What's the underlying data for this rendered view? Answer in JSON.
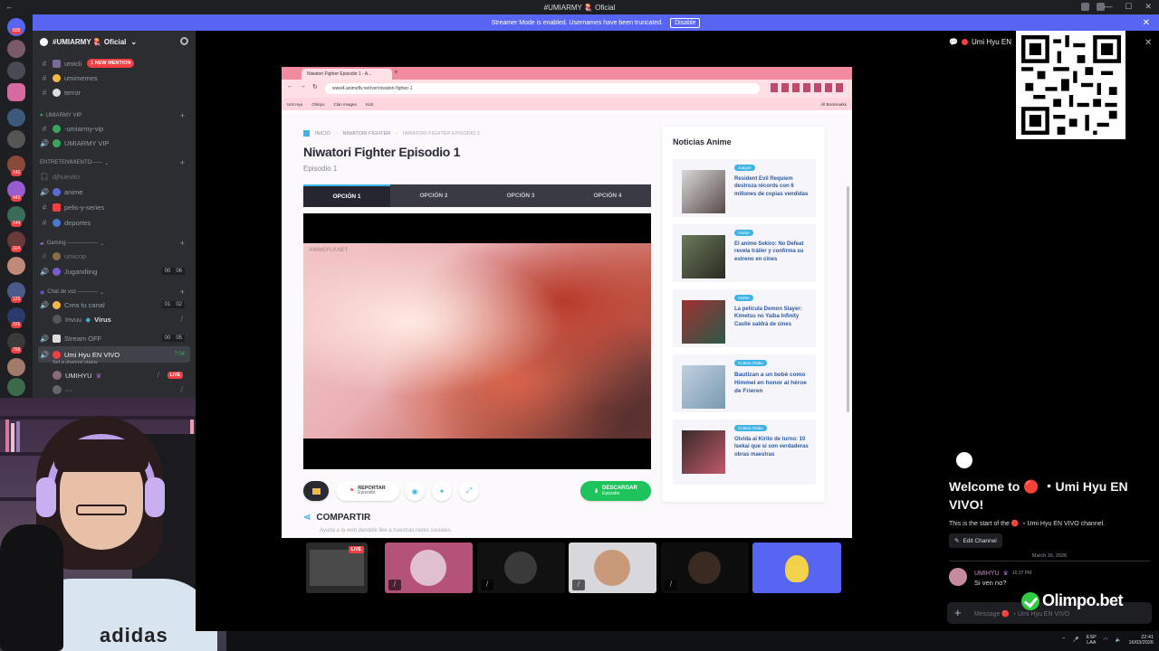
{
  "window": {
    "title": "#UMIARMY 🪼 Oficial"
  },
  "banner": {
    "text": "Streamer Mode is enabled. Usernames have been truncated.",
    "disable_label": "Disable"
  },
  "rail": {
    "badges": [
      "608",
      "142",
      "443",
      "144",
      "114",
      "123",
      "166",
      "768",
      "871"
    ]
  },
  "server": {
    "name": "#UMIARMY 🪼 Oficial"
  },
  "channels": {
    "umiclip": "umicli",
    "new_mention": "1 NEW MENTION",
    "umimemes": "umimemes",
    "terror": "terror",
    "cat_vip": "UMIARMY VIP",
    "umiarmy_vip_text": "-umiarmy-vip",
    "umiarmy_vip_voice": "UMIARMY VIP",
    "cat_entretenimiento": "ENTRETENIMIENTO------",
    "djhuevito": "djhuevito",
    "anime": "anime",
    "pelis": "pelis-y-series",
    "deportes": "deportes",
    "cat_gaming": "Gaming -----------------",
    "umicop": "umicop",
    "jugandig": "Jugandiing",
    "jugandig_c1": "00",
    "jugandig_c2": "06",
    "cat_voz": "Chat de voz -----------",
    "crea": "Crea tu canal",
    "crea_c1": "01",
    "crea_c2": "02",
    "crea_user": "Invuu",
    "crea_user2": "Virus",
    "streamoff": "Stream OFF",
    "streamoff_c1": "00",
    "streamoff_c2": "05",
    "umihyu": "Umi Hyu EN VIVO",
    "umihyu_time": "7:04",
    "status": "Set a channel status",
    "member": "UMIHYU",
    "live": "LIVE"
  },
  "browser": {
    "tab": "Niwatori Fighter Episodio 1 - A...",
    "url": "www4.animeflv.net/ver/niwatori-fighter-1",
    "bookmarks": [
      "Umi Hyu",
      "Olimpo",
      "Clan Imagen",
      "Kick",
      "All Bookmarks"
    ],
    "breadcrumb": [
      "INICIO",
      "NIWATORI FIGHTER",
      "NIWATORI FIGHTER EPISODIO 1"
    ],
    "title": "Niwatori Fighter Episodio 1",
    "subtitle": "Episodio 1",
    "options": [
      "OPCIÓN 1",
      "OPCIÓN 2",
      "OPCIÓN 3",
      "OPCIÓN 4"
    ],
    "watermark": "ANIMEFLV.NET",
    "report_l1": "REPORTAR",
    "report_l2": "Episodio",
    "download_l1": "DESCARGAR",
    "download_l2": "Episodio",
    "share": "COMPARTIR",
    "share_sub": "Ayuda a la web dandole like a nuestras redes sociales.",
    "news_title": "Noticias Anime",
    "news": [
      {
        "tag": "Juegos",
        "text": "Resident Evil Requiem destroza récords con 6 millones de copias vendidas"
      },
      {
        "tag": "Anime",
        "text": "El anime Sekiro: No Defeat revela tráiler y confirma su estreno en cines"
      },
      {
        "tag": "Anime",
        "text": "La película Demon Slayer: Kimetsu no Yaiba Infinity Castle saldrá de cines"
      },
      {
        "tag": "Cultura Otaku",
        "text": "Bautizan a un bebé como Himmel en honor al héroe de Frieren"
      },
      {
        "tag": "Cultura Otaku",
        "text": "Olvida al Kirito de turno: 10 Isekai que sí son verdaderas obras maestras"
      }
    ]
  },
  "tiles": {
    "live": "LIVE"
  },
  "chat": {
    "header": "Umi Hyu EN",
    "welcome": "Welcome to 🔴 ・Umi Hyu EN VIVO!",
    "welcome_sub": "This is the start of the 🔴 ・Umi Hyu EN VIVO channel.",
    "edit_channel": "Edit Channel",
    "date": "March 16, 2026",
    "msg_user": "UMIHYU",
    "msg_time": "10:37 PM",
    "msg_text": "Si ven no?",
    "input_placeholder": "Message 🔴 ・Umi Hyu EN VIVO"
  },
  "sponsor": {
    "name": "Olimpo.bet"
  },
  "tray": {
    "lang1": "ESP",
    "lang2": "LAA",
    "time": "22:41",
    "date": "16/03/2026"
  },
  "colors": {
    "blurple": "#5865f2",
    "rail": "#1e1f22",
    "sidebar": "#2b2d31",
    "live_red": "#f23f43",
    "download_green": "#1ec45b",
    "news_blue": "#2e5a9e"
  }
}
